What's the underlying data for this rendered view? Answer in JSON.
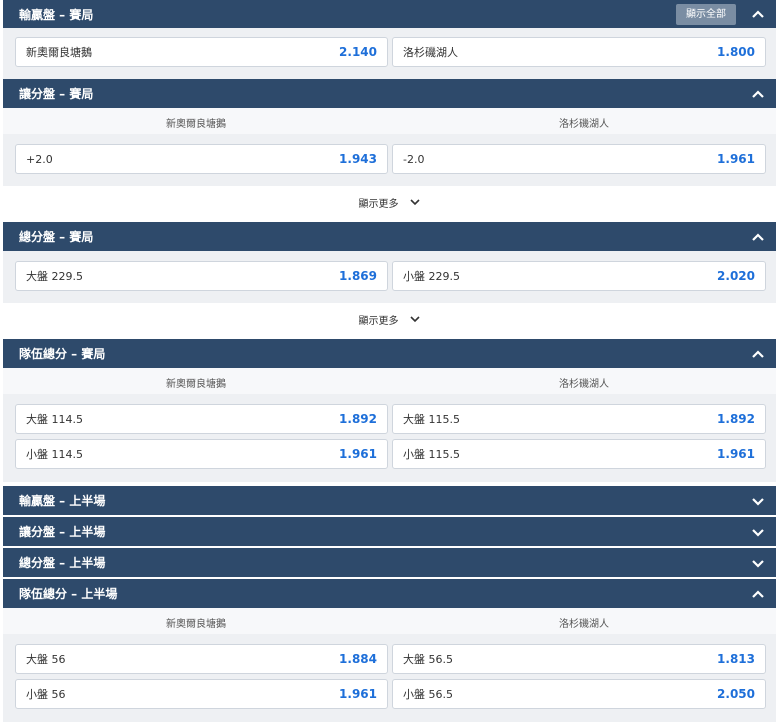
{
  "show_all_label": "顯示全部",
  "show_more_label": "顯示更多",
  "sections": [
    {
      "title": "輸贏盤 – 賽局",
      "expanded": true,
      "options": [
        {
          "label": "新奧爾良塘鵝",
          "price": "2.140"
        },
        {
          "label": "洛杉磯湖人",
          "price": "1.800"
        }
      ]
    },
    {
      "title": "讓分盤 – 賽局",
      "expanded": true,
      "columns": [
        "新奧爾良塘鵝",
        "洛杉磯湖人"
      ],
      "options": [
        {
          "label": "+2.0",
          "price": "1.943"
        },
        {
          "label": "-2.0",
          "price": "1.961"
        }
      ]
    },
    {
      "title": "總分盤 – 賽局",
      "expanded": true,
      "options": [
        {
          "label": "大盤 229.5",
          "price": "1.869"
        },
        {
          "label": "小盤 229.5",
          "price": "2.020"
        }
      ]
    },
    {
      "title": "隊伍總分 – 賽局",
      "expanded": true,
      "columns": [
        "新奧爾良塘鵝",
        "洛杉磯湖人"
      ],
      "options": [
        {
          "label": "大盤 114.5",
          "price": "1.892"
        },
        {
          "label": "大盤 115.5",
          "price": "1.892"
        },
        {
          "label": "小盤 114.5",
          "price": "1.961"
        },
        {
          "label": "小盤 115.5",
          "price": "1.961"
        }
      ]
    },
    {
      "title": "輸贏盤 – 上半場",
      "expanded": false
    },
    {
      "title": "讓分盤 – 上半場",
      "expanded": false
    },
    {
      "title": "總分盤 – 上半場",
      "expanded": false
    },
    {
      "title": "隊伍總分 – 上半場",
      "expanded": true,
      "columns": [
        "新奧爾良塘鵝",
        "洛杉磯湖人"
      ],
      "options": [
        {
          "label": "大盤 56",
          "price": "1.884"
        },
        {
          "label": "大盤 56.5",
          "price": "1.813"
        },
        {
          "label": "小盤 56",
          "price": "1.961"
        },
        {
          "label": "小盤 56.5",
          "price": "2.050"
        }
      ]
    }
  ]
}
